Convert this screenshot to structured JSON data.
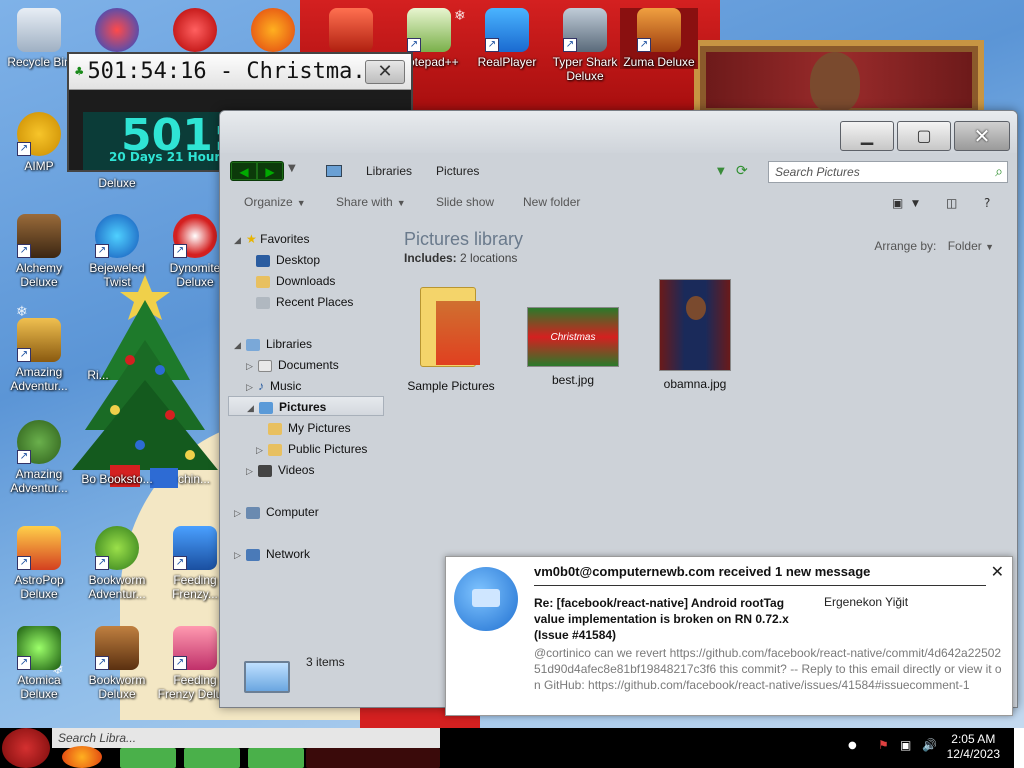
{
  "desktop": {
    "icons": [
      {
        "label": "Recycle Bin"
      },
      {
        "label": "AIMP"
      },
      {
        "label": "Alchemy Deluxe"
      },
      {
        "label": "Bejeweled Twist"
      },
      {
        "label": "Dynomite Deluxe"
      },
      {
        "label": "Amazing Adventur..."
      },
      {
        "label": "Amazing Adventur..."
      },
      {
        "label": "AstroPop Deluxe"
      },
      {
        "label": "Bookworm Adventur..."
      },
      {
        "label": "Feeding Frenzy..."
      },
      {
        "label": "Atomica Deluxe"
      },
      {
        "label": "Bookworm Deluxe"
      },
      {
        "label": "Feeding Frenzy Delu..."
      },
      {
        "label": "Notepad++"
      },
      {
        "label": "RealPlayer"
      },
      {
        "label": "Typer Shark Deluxe"
      },
      {
        "label": "Zuma Deluxe"
      },
      {
        "label": "Deluxe"
      },
      {
        "label": "Bo Booksto..."
      },
      {
        "label": "chin..."
      },
      {
        "label": "Ri..."
      }
    ]
  },
  "countdown": {
    "title": "501:54:16 - Christma...",
    "big": "501:",
    "small": "20 Days 21 Hours"
  },
  "explorer": {
    "breadcrumbs": [
      "Libraries",
      "Pictures"
    ],
    "search_placeholder": "Search Pictures",
    "toolbar": {
      "organize": "Organize",
      "share": "Share with",
      "slideshow": "Slide show",
      "newfolder": "New folder"
    },
    "nav": {
      "favorites": "Favorites",
      "desktop": "Desktop",
      "downloads": "Downloads",
      "recent": "Recent Places",
      "libraries": "Libraries",
      "documents": "Documents",
      "music": "Music",
      "pictures": "Pictures",
      "mypictures": "My Pictures",
      "publicpictures": "Public Pictures",
      "videos": "Videos",
      "computer": "Computer",
      "network": "Network"
    },
    "library_title": "Pictures library",
    "includes_label": "Includes:",
    "includes_value": "2 locations",
    "arrange_label": "Arrange by:",
    "arrange_value": "Folder",
    "files": [
      {
        "name": "Sample Pictures"
      },
      {
        "name": "best.jpg"
      },
      {
        "name": "obamna.jpg"
      }
    ],
    "best_thumb_text": "Christmas",
    "status": "3 items"
  },
  "notification": {
    "title": "vm0b0t@computernewb.com received 1 new message",
    "subject": "Re: [facebook/react-native] Android rootTag value implementation is broken on RN 0.72.x (Issue #41584)",
    "from": "Ergenekon Yiğit",
    "body": "@cortinico can we revert https://github.com/facebook/react-native/commit/4d642a2250251d90d4afec8e81bf19848217c3f6 this commit? -- Reply to this email directly or view it on GitHub: https://github.com/facebook/react-native/issues/41584#issuecomment-1"
  },
  "taskbar": {
    "search_placeholder": "Search Libra...",
    "time": "2:05 AM",
    "date": "12/4/2023"
  },
  "colors": {
    "desktop_blue": "#5b95d6",
    "festive_red": "#d42020",
    "countdown_teal": "#2fe4d4",
    "window_chrome": "#cdd2d8"
  }
}
